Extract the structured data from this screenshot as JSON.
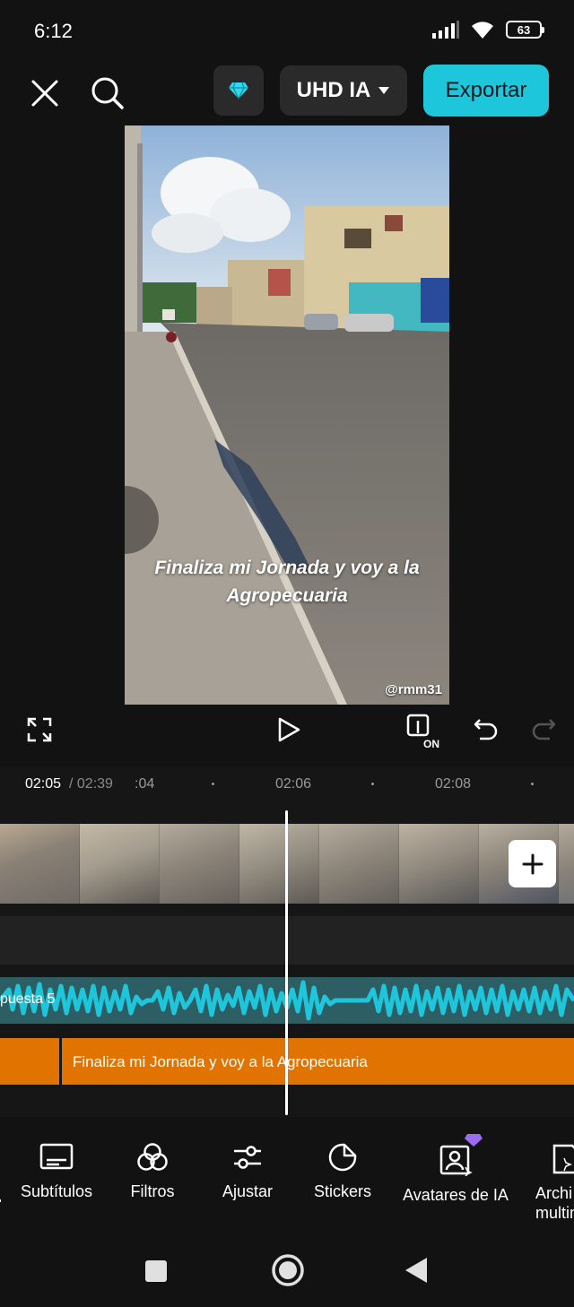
{
  "status_bar": {
    "time": "6:12",
    "battery": "63"
  },
  "top_bar": {
    "quality_label": "UHD IA",
    "export_label": "Exportar"
  },
  "preview": {
    "caption": "Finaliza mi Jornada y voy a la Agropecuaria",
    "watermark": "@rmm31"
  },
  "timeline": {
    "current_time": "02:05",
    "total_time": "/ 02:39",
    "ticks": [
      ":04",
      "02:06",
      "02:08"
    ],
    "audio_label": "puesta 5",
    "text_clip_label": "Finaliza mi Jornada y voy a la Agropecuaria"
  },
  "tools": [
    {
      "label": "Subtítulos",
      "icon": "subtitles-icon"
    },
    {
      "label": "Filtros",
      "icon": "filters-icon"
    },
    {
      "label": "Ajustar",
      "icon": "adjust-icon"
    },
    {
      "label": "Stickers",
      "icon": "stickers-icon"
    },
    {
      "label": "Avatares de IA",
      "icon": "ai-avatar-icon"
    },
    {
      "label": "Archivos multimedia",
      "label_line1": "Archi",
      "label_line2": "multim",
      "icon": "media-icon"
    }
  ],
  "colors": {
    "accent": "#1ec6dc",
    "audio_wave": "#1ec6dc",
    "audio_track": "#2d5e63",
    "text_track": "#e17400",
    "premium": "#9b6cf0"
  }
}
